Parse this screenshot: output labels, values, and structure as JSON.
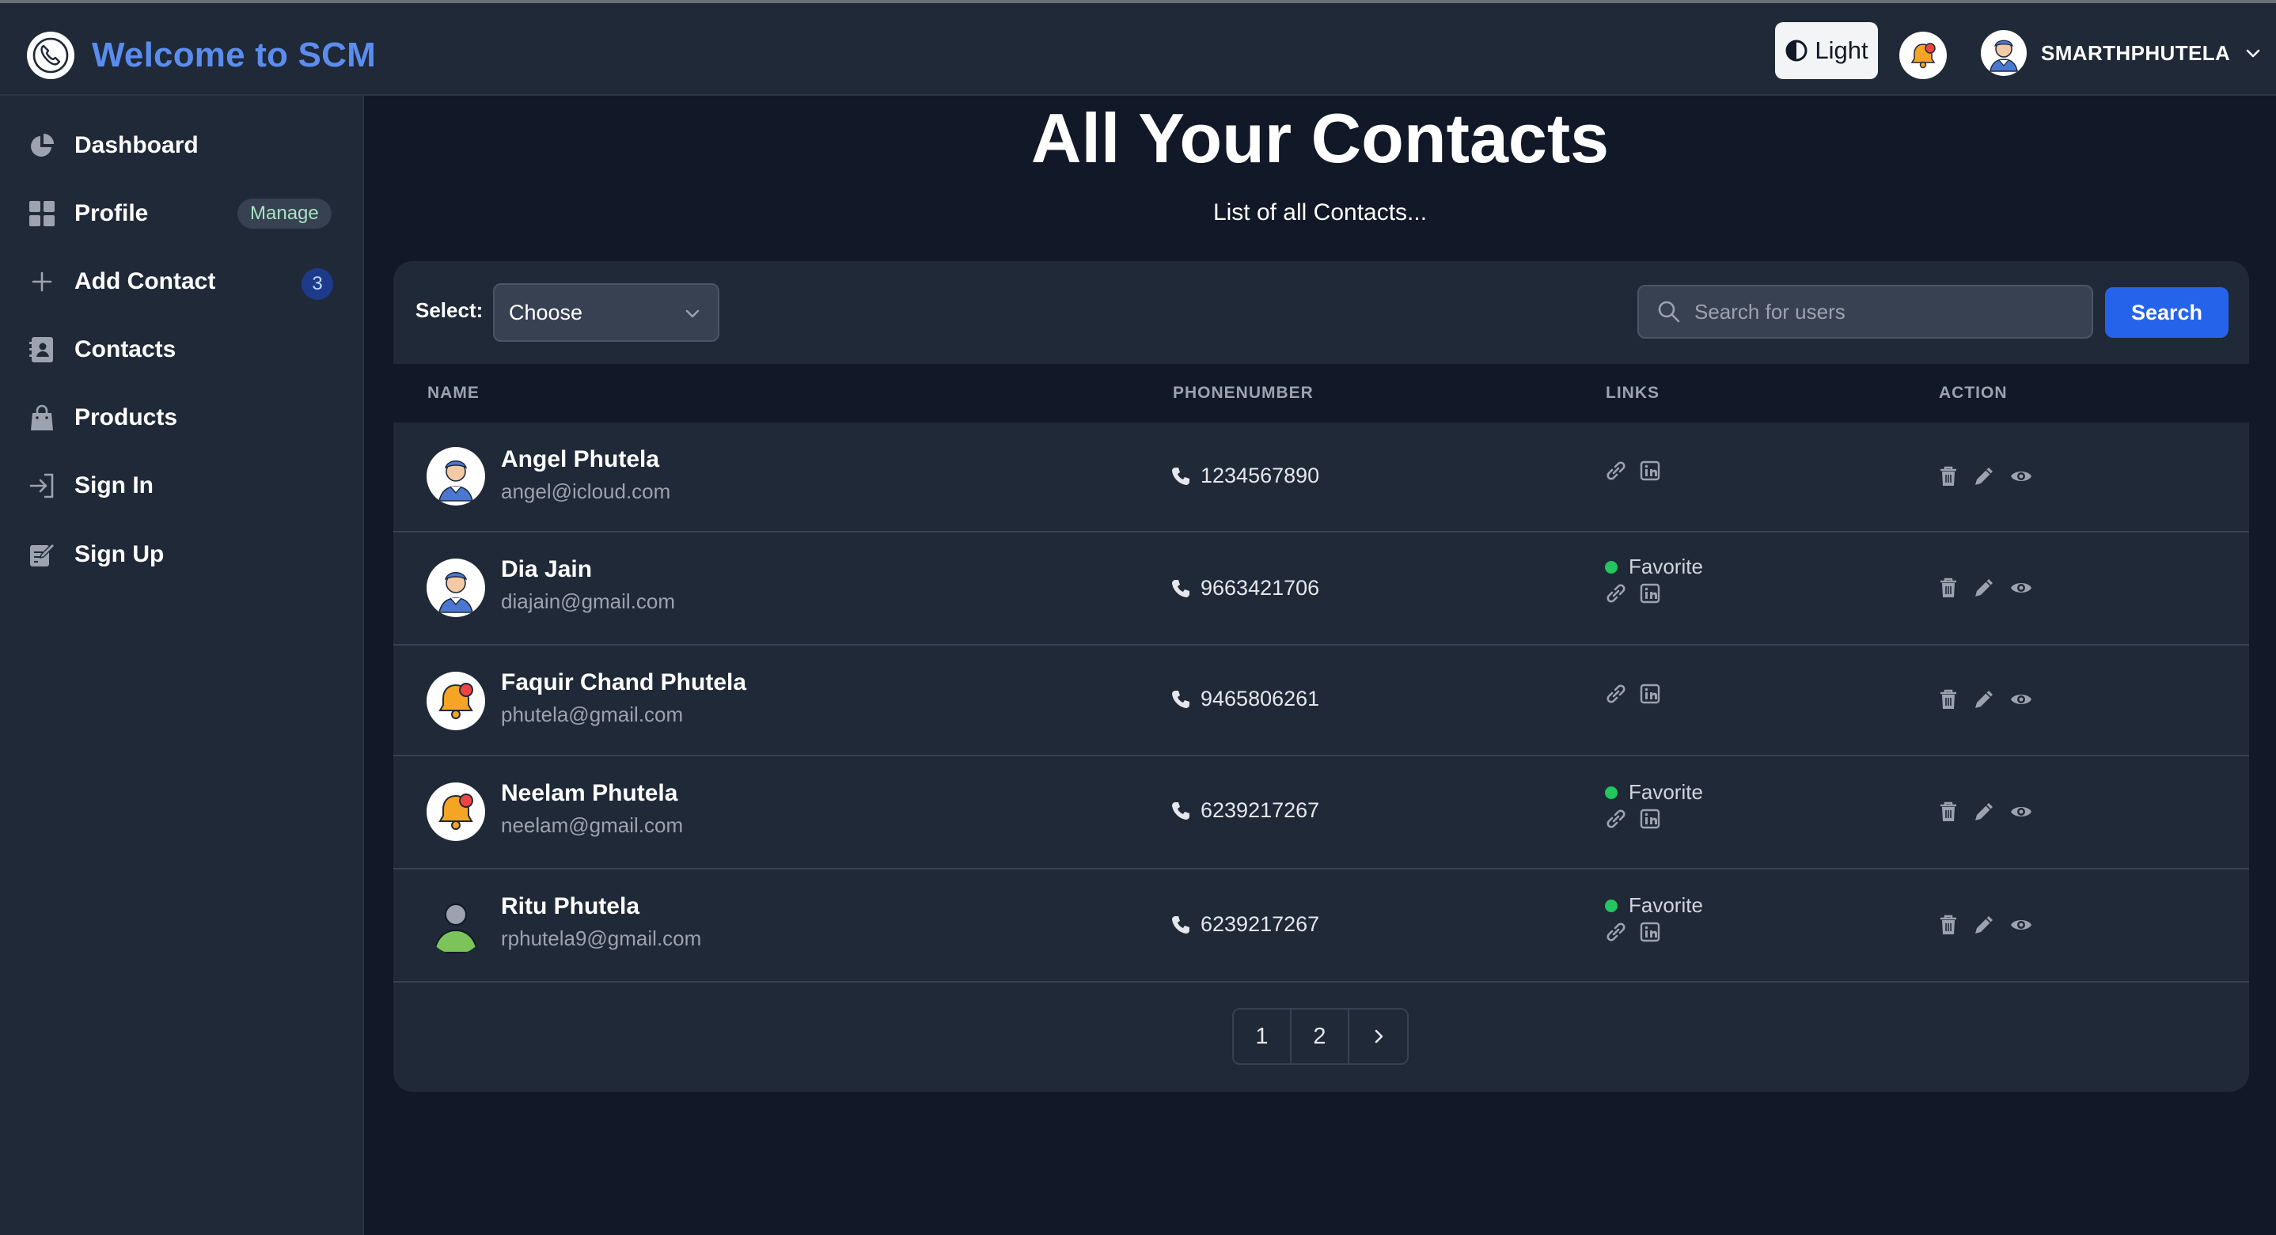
{
  "app": {
    "title": "Welcome to SCM"
  },
  "navbar": {
    "theme_label": "Light",
    "username": "SMARTHPHUTELA"
  },
  "sidebar": {
    "items": [
      {
        "label": "Dashboard",
        "icon": "chart-pie-icon"
      },
      {
        "label": "Profile",
        "icon": "grid-icon",
        "badge": "Manage"
      },
      {
        "label": "Add Contact",
        "icon": "plus-icon",
        "badge": "3"
      },
      {
        "label": "Contacts",
        "icon": "address-book-icon"
      },
      {
        "label": "Products",
        "icon": "shopping-bag-icon"
      },
      {
        "label": "Sign In",
        "icon": "sign-in-icon"
      },
      {
        "label": "Sign Up",
        "icon": "sign-up-icon"
      }
    ]
  },
  "main": {
    "title": "All Your Contacts",
    "subtitle": "List of all Contacts..."
  },
  "filters": {
    "select_label": "Select:",
    "select_value": "Choose",
    "search_placeholder": "Search for users",
    "search_button": "Search"
  },
  "table": {
    "headers": [
      "NAME",
      "PHONENUMBER",
      "LINKS",
      "ACTION"
    ],
    "rows": [
      {
        "name": "Angel Phutela",
        "email": "angel@icloud.com",
        "phone": "1234567890",
        "favorite": "",
        "avatar": "man-avatar"
      },
      {
        "name": "Dia Jain",
        "email": "diajain@gmail.com",
        "phone": "9663421706",
        "favorite": "Favorite",
        "avatar": "man-avatar"
      },
      {
        "name": "Faquir Chand Phutela",
        "email": "phutela@gmail.com",
        "phone": "9465806261",
        "favorite": "",
        "avatar": "bell-avatar"
      },
      {
        "name": "Neelam Phutela",
        "email": "neelam@gmail.com",
        "phone": "6239217267",
        "favorite": "Favorite",
        "avatar": "bell-avatar"
      },
      {
        "name": "Ritu Phutela",
        "email": "rphutela9@gmail.com",
        "phone": "6239217267",
        "favorite": "Favorite",
        "avatar": "person-avatar"
      }
    ]
  },
  "pagination": {
    "pages": [
      "1",
      "2"
    ]
  },
  "colors": {
    "accent": "#2563eb",
    "brand": "#5b8def",
    "favorite_dot": "#22c55e",
    "background": "#111827",
    "surface": "#1f2937"
  }
}
